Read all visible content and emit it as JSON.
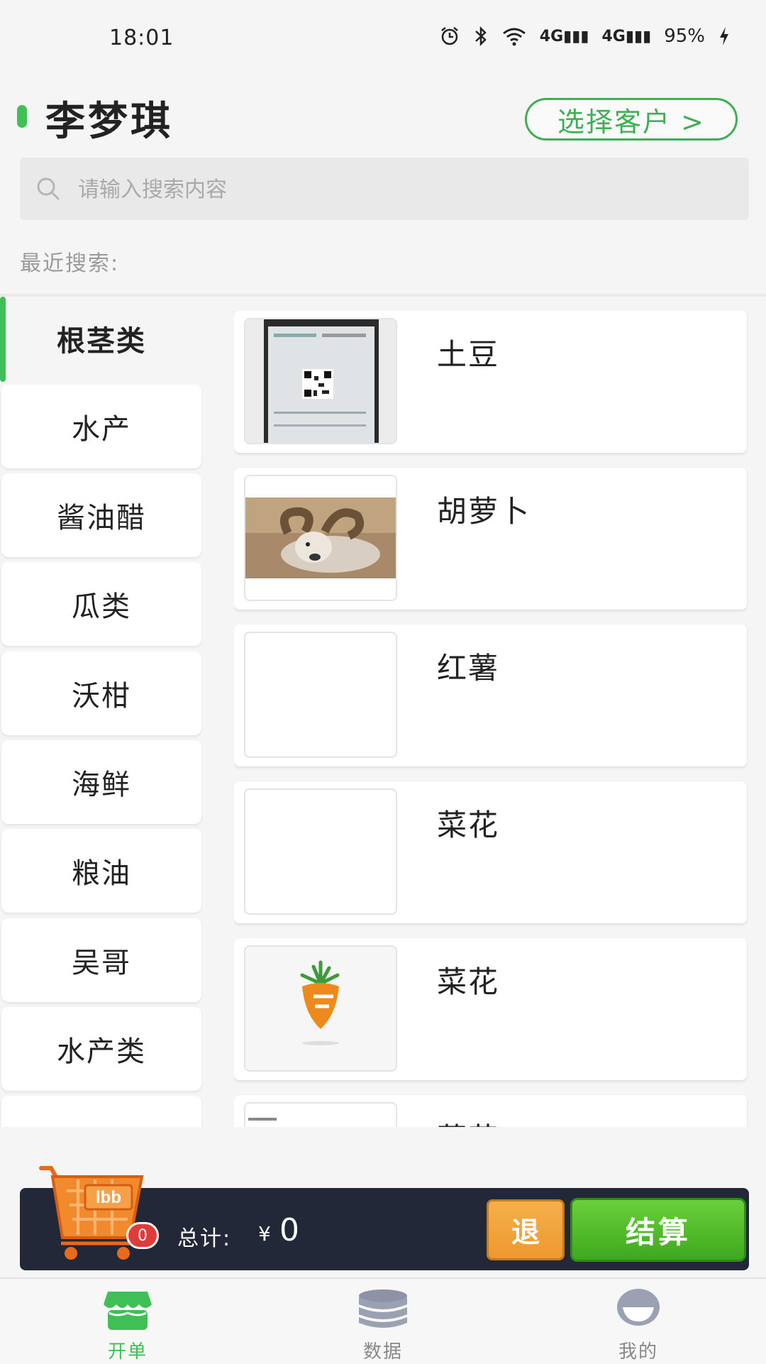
{
  "status_bar": {
    "time": "18:01",
    "battery": "95%",
    "network_1": "4G",
    "network_2": "4G"
  },
  "header": {
    "customer_name": "李梦琪",
    "select_customer_label": "选择客户 >"
  },
  "search": {
    "placeholder": "请输入搜索内容",
    "value": "",
    "recent_label": "最近搜索:"
  },
  "categories": [
    {
      "label": "根茎类",
      "active": true
    },
    {
      "label": "水产"
    },
    {
      "label": "酱油醋"
    },
    {
      "label": "瓜类"
    },
    {
      "label": "沃柑"
    },
    {
      "label": "海鲜"
    },
    {
      "label": "粮油"
    },
    {
      "label": "吴哥"
    },
    {
      "label": "水产类"
    },
    {
      "label": ""
    }
  ],
  "products": [
    {
      "name": "土豆",
      "thumbnail": "qr-code-photo"
    },
    {
      "name": "胡萝卜",
      "thumbnail": "ram-photo"
    },
    {
      "name": "红薯",
      "thumbnail": "empty"
    },
    {
      "name": "菜花",
      "thumbnail": "empty"
    },
    {
      "name": "菜花",
      "thumbnail": "carrot-logo"
    },
    {
      "name": "菜花",
      "thumbnail": "document-photo"
    }
  ],
  "cart": {
    "badge_text": "lbb",
    "count": "0",
    "total_label": "总计:",
    "currency": "¥",
    "total_value": "0",
    "refund_label": "退",
    "checkout_label": "结算"
  },
  "tabs": [
    {
      "label": "开单",
      "icon": "store-icon",
      "active": true
    },
    {
      "label": "数据",
      "icon": "database-icon"
    },
    {
      "label": "我的",
      "icon": "profile-icon"
    }
  ],
  "colors": {
    "accent": "#3fbf55",
    "cart_bar": "#232838",
    "refund": "#f0a03a",
    "checkout": "#52bd2c",
    "badge": "#e03b3b"
  }
}
